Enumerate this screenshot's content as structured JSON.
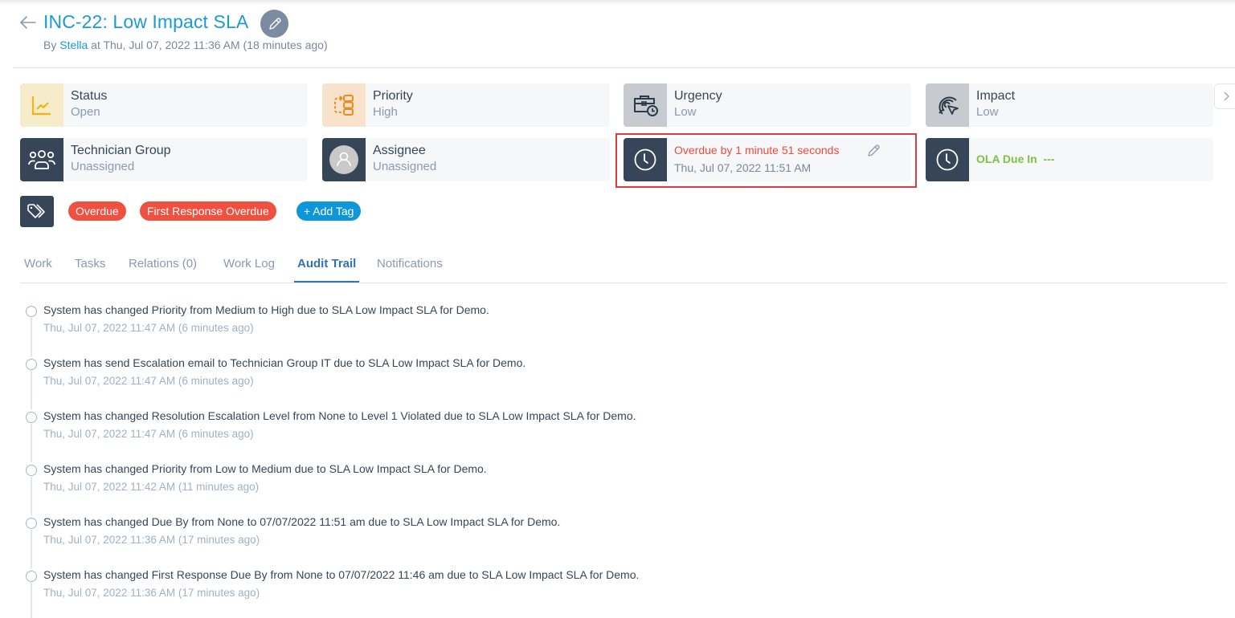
{
  "header": {
    "title": "INC-22: Low Impact SLA",
    "byline_prefix": "By",
    "author": "Stella",
    "byline_suffix": "at Thu, Jul 07, 2022 11:36 AM (18 minutes ago)"
  },
  "cards": {
    "status": {
      "label": "Status",
      "value": "Open",
      "icon": "trend-chart-icon"
    },
    "priority": {
      "label": "Priority",
      "value": "High",
      "icon": "flow-priority-icon"
    },
    "urgency": {
      "label": "Urgency",
      "value": "Low",
      "icon": "briefcase-clock-icon"
    },
    "impact": {
      "label": "Impact",
      "value": "Low",
      "icon": "target-cursor-icon"
    },
    "technician_group": {
      "label": "Technician Group",
      "value": "Unassigned",
      "icon": "group-icon"
    },
    "assignee": {
      "label": "Assignee",
      "value": "Unassigned",
      "icon": "avatar-icon"
    },
    "due": {
      "label": "Overdue by 1 minute 51 seconds",
      "value": "Thu, Jul 07, 2022 11:51 AM",
      "icon": "clock-icon"
    },
    "ola": {
      "label": "OLA Due In",
      "value": "---",
      "icon": "clock-icon"
    }
  },
  "tags": [
    {
      "label": "Overdue",
      "color": "#ef5040"
    },
    {
      "label": "First Response Overdue",
      "color": "#ef5040"
    }
  ],
  "add_tag_label": "+ Add Tag",
  "tabs": [
    {
      "label": "Work",
      "active": false
    },
    {
      "label": "Tasks",
      "active": false
    },
    {
      "label": "Relations (0)",
      "active": false
    },
    {
      "label": "Work Log",
      "active": false
    },
    {
      "label": "Audit Trail",
      "active": true
    },
    {
      "label": "Notifications",
      "active": false
    }
  ],
  "audit_trail": [
    {
      "text": "System has changed Priority from Medium to High due to SLA Low Impact SLA for Demo.",
      "time": "Thu, Jul 07, 2022 11:47 AM (6 minutes ago)"
    },
    {
      "text": "System has send Escalation email to Technician Group IT due to SLA Low Impact SLA for Demo.",
      "time": "Thu, Jul 07, 2022 11:47 AM (6 minutes ago)"
    },
    {
      "text": "System has changed Resolution Escalation Level from None to Level 1 Violated due to SLA Low Impact SLA for Demo.",
      "time": "Thu, Jul 07, 2022 11:47 AM (6 minutes ago)"
    },
    {
      "text": "System has changed Priority from Low to Medium due to SLA Low Impact SLA for Demo.",
      "time": "Thu, Jul 07, 2022 11:42 AM (11 minutes ago)"
    },
    {
      "text": "System has changed Due By from None to 07/07/2022 11:51 am due to SLA Low Impact SLA for Demo.",
      "time": "Thu, Jul 07, 2022 11:36 AM (17 minutes ago)"
    },
    {
      "text": "System has changed First Response Due By from None to 07/07/2022 11:46 am due to SLA Low Impact SLA for Demo.",
      "time": "Thu, Jul 07, 2022 11:36 AM (17 minutes ago)"
    }
  ],
  "colors": {
    "brand": "#1a9ad6",
    "overdue": "#ef4a3f",
    "ola": "#7dc242",
    "active_tab": "#2e74b5"
  }
}
